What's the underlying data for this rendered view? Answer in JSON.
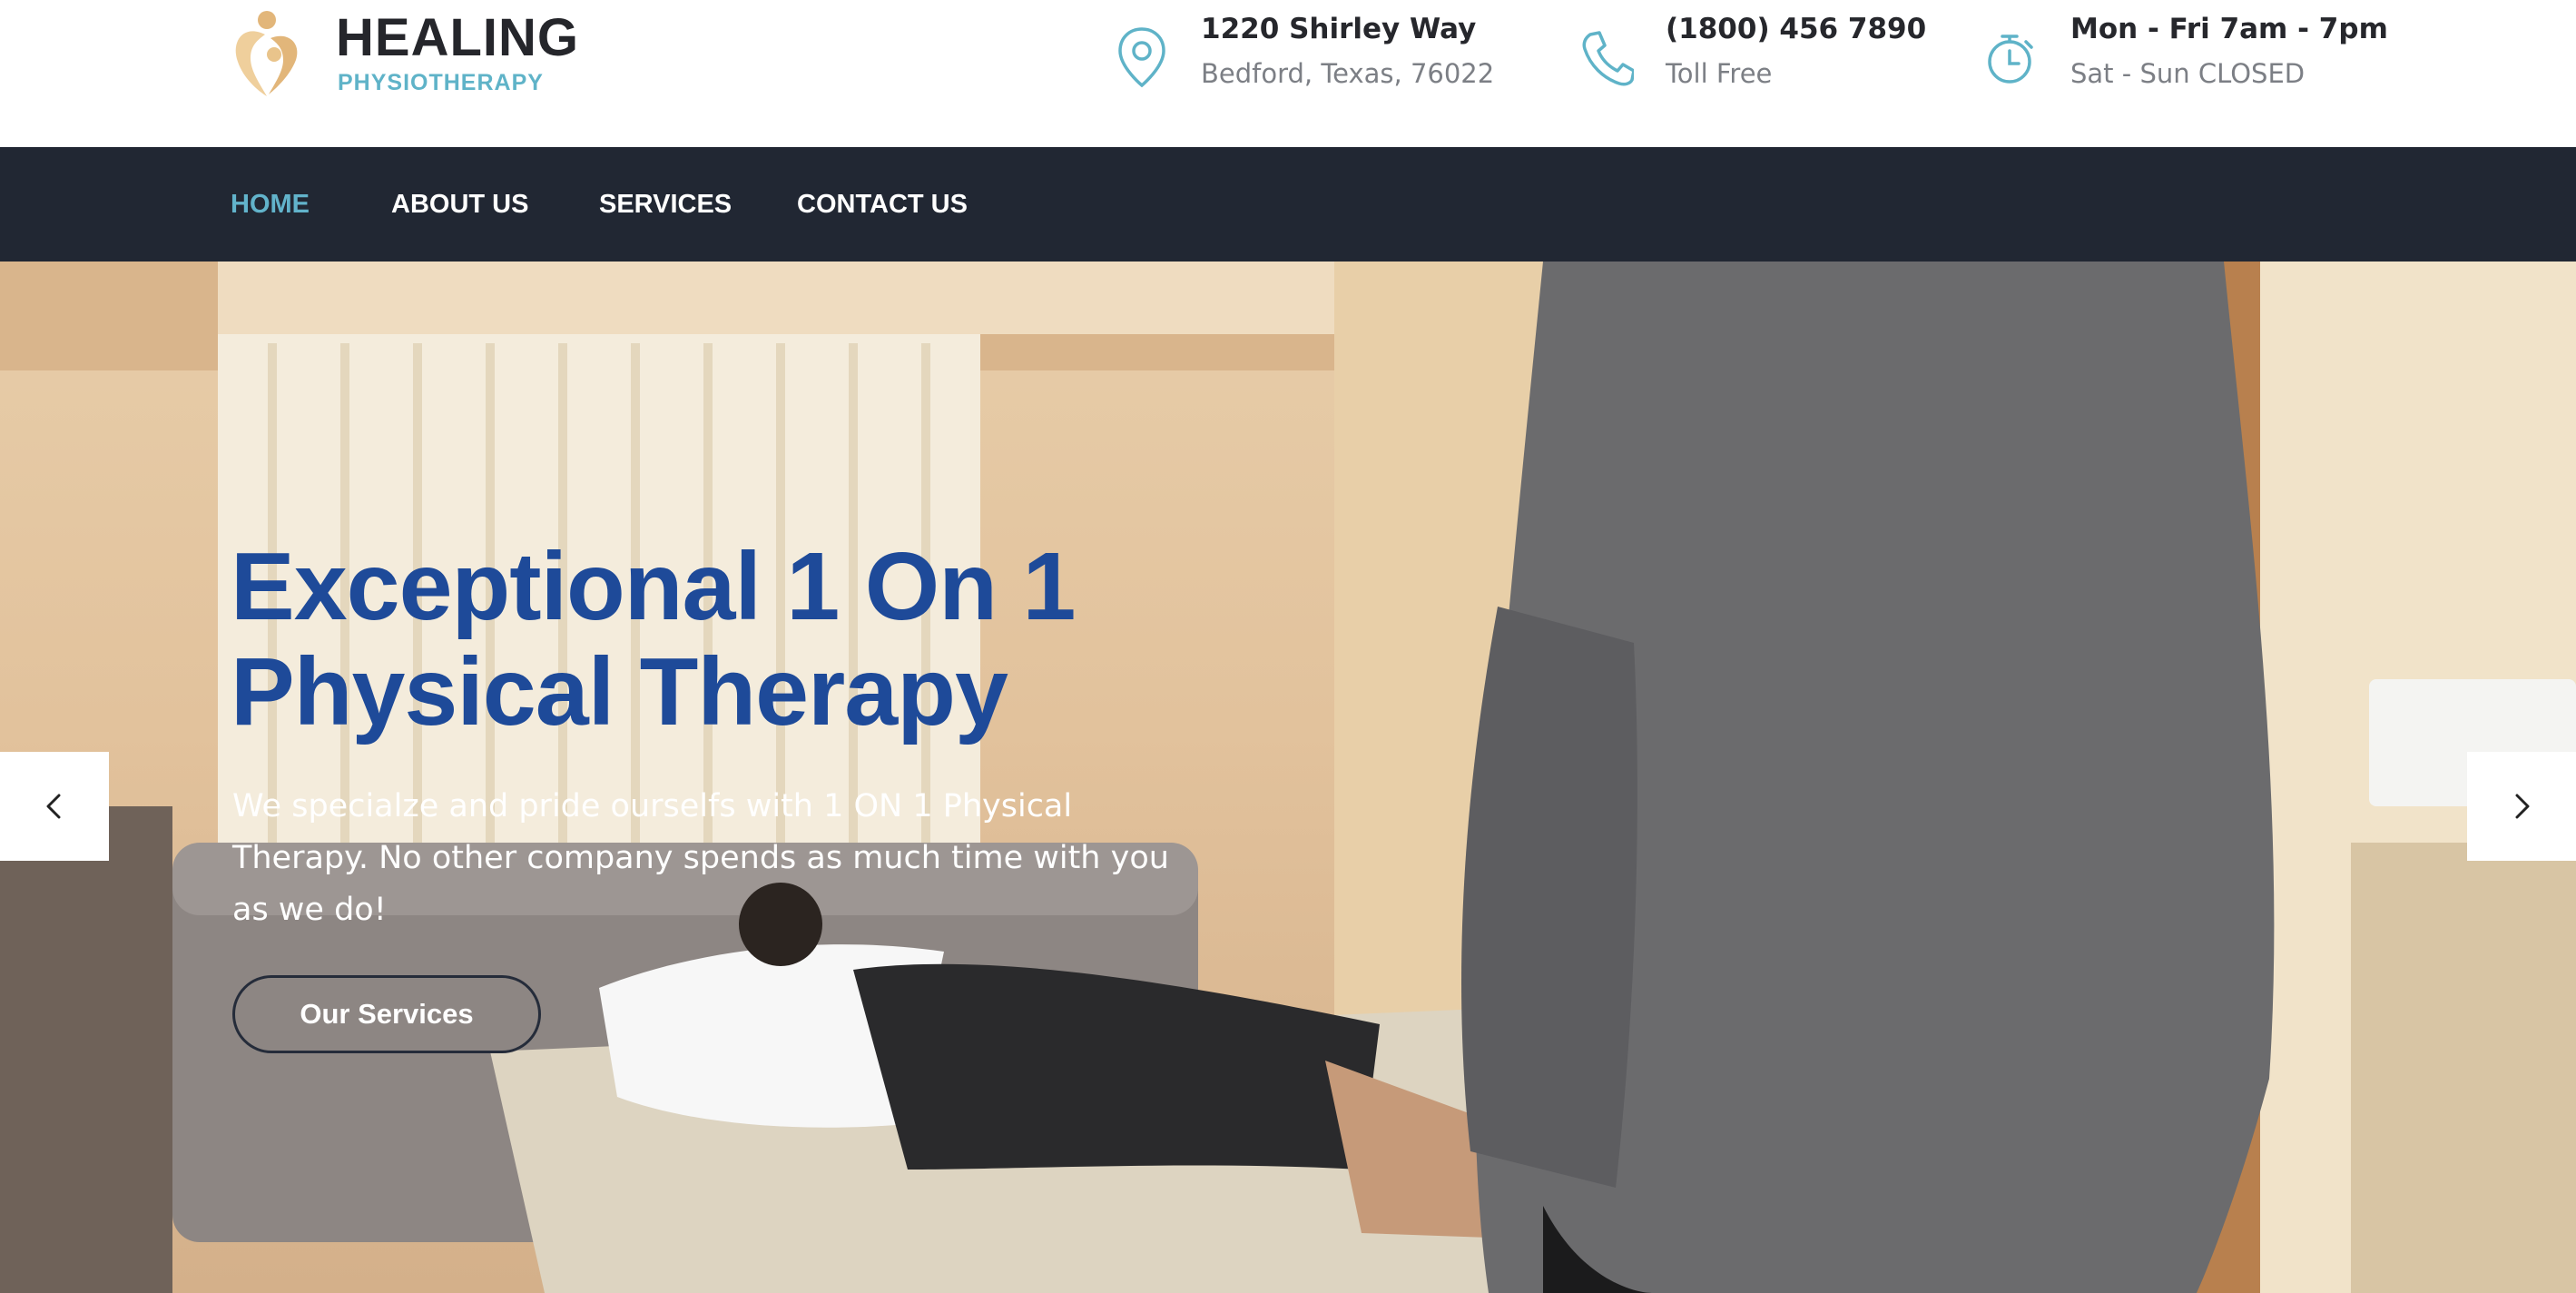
{
  "brand": {
    "name": "HEALING",
    "tagline": "PHYSIOTHERAPY"
  },
  "contact": {
    "address_line1": "1220 Shirley Way",
    "address_line2": "Bedford, Texas, 76022",
    "phone_line1": "(1800) 456 7890",
    "phone_line2": "Toll Free",
    "hours_line1": "Mon - Fri 7am - 7pm",
    "hours_line2": "Sat - Sun CLOSED"
  },
  "nav": {
    "items": [
      {
        "label": "HOME",
        "active": true
      },
      {
        "label": "ABOUT US",
        "active": false
      },
      {
        "label": "SERVICES",
        "active": false
      },
      {
        "label": "CONTACT US",
        "active": false
      }
    ]
  },
  "hero": {
    "title_line1": "Exceptional 1 On 1",
    "title_line2": "Physical Therapy",
    "description": "We specialze and pride ourselfs with 1 ON 1 Physical Therapy. No other company spends as much time with you as we do!",
    "button_label": "Our Services"
  },
  "icons": {
    "logo": "heart-figure-logo-icon",
    "address": "map-pin-icon",
    "phone": "phone-icon",
    "hours": "stopwatch-icon",
    "prev": "chevron-left-icon",
    "next": "chevron-right-icon"
  },
  "colors": {
    "nav_background": "#212733",
    "nav_active": "#62b3cb",
    "hero_title": "#1e4a99",
    "accent_teal": "#5fb3c8",
    "logo_gold": "#e2b67a"
  }
}
